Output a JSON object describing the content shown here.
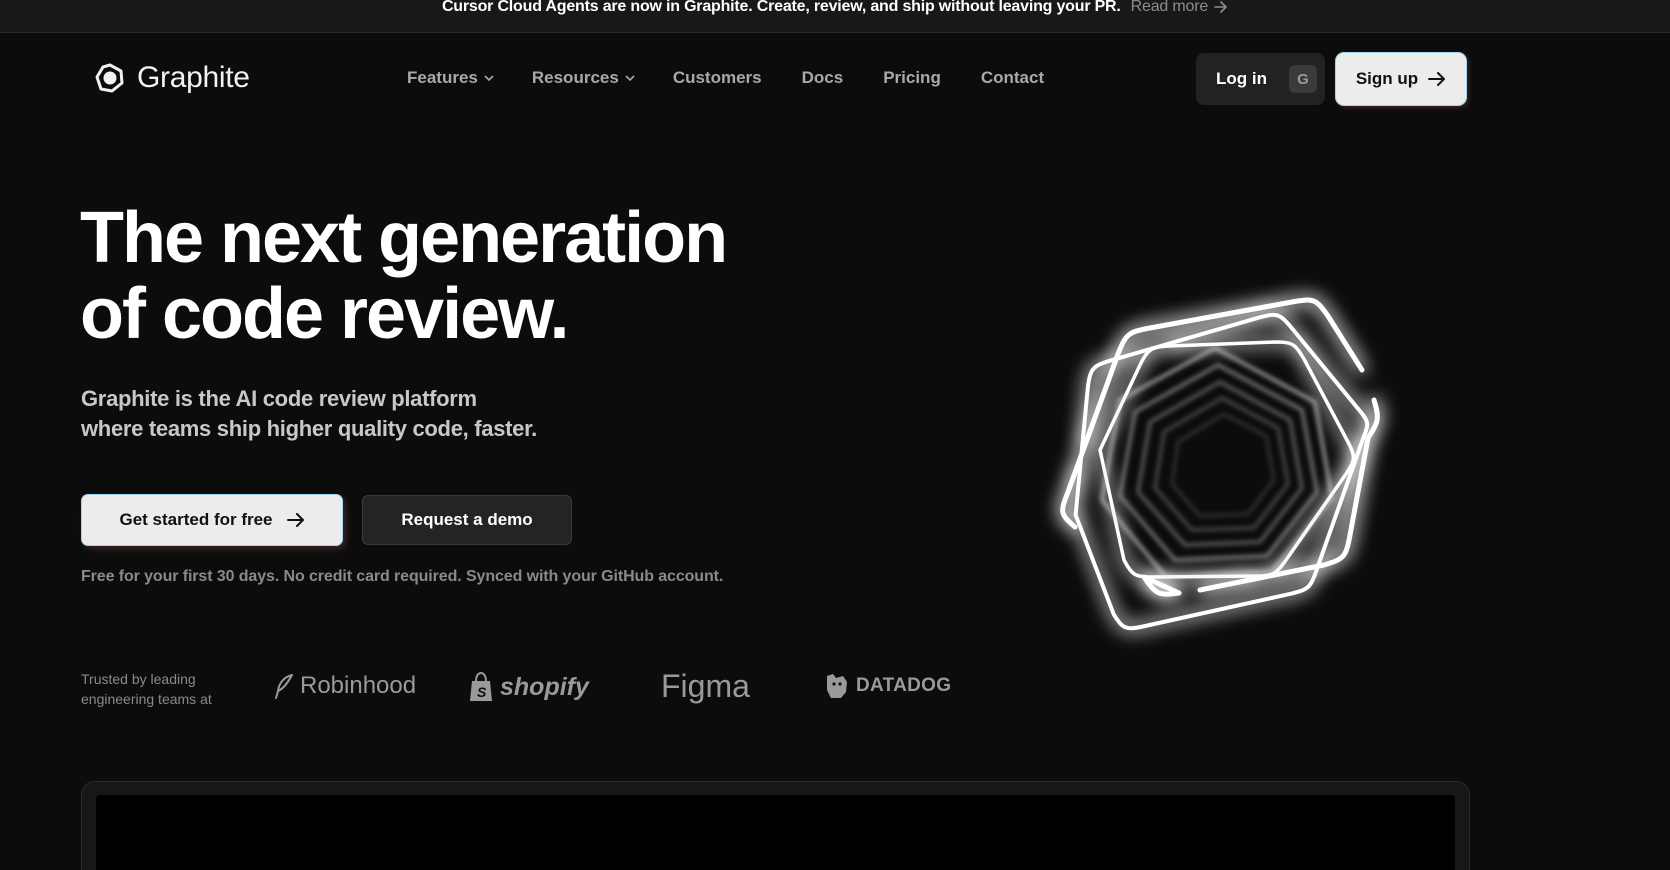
{
  "announcement": {
    "message": "Cursor Cloud Agents are now in Graphite. Create, review, and ship without leaving your PR.",
    "link": "Read more"
  },
  "header": {
    "logo_text": "Graphite",
    "nav": [
      {
        "label": "Features",
        "has_dropdown": true
      },
      {
        "label": "Resources",
        "has_dropdown": true
      },
      {
        "label": "Customers",
        "has_dropdown": false
      },
      {
        "label": "Docs",
        "has_dropdown": false
      },
      {
        "label": "Pricing",
        "has_dropdown": false
      },
      {
        "label": "Contact",
        "has_dropdown": false
      }
    ],
    "login_label": "Log in",
    "login_shortcut": "G",
    "signup_label": "Sign up"
  },
  "hero": {
    "headline_line1": "The next generation",
    "headline_line2": "of code review.",
    "subtitle_line1": "Graphite is the AI code review platform",
    "subtitle_line2": "where teams ship higher quality code, faster.",
    "cta_primary": "Get started for free",
    "cta_secondary": "Request a demo",
    "fineprint": "Free for your first 30 days. No credit card required. Synced with your GitHub account."
  },
  "trusted": {
    "label_line1": "Trusted by leading",
    "label_line2": "engineering teams at",
    "brands": [
      "Robinhood",
      "shopify",
      "Figma",
      "DATADOG"
    ]
  },
  "colors": {
    "background": "#0c0c0c",
    "announcement_bg": "#181818",
    "primary_button_bg": "#ececec",
    "primary_button_border": "#9fd6ef",
    "secondary_button_bg": "#242424",
    "muted_text": "#8a8a8a"
  },
  "icons": {
    "logo": "graphite-logo-icon",
    "arrow": "arrow-right-icon",
    "chevron": "chevron-down-icon"
  }
}
